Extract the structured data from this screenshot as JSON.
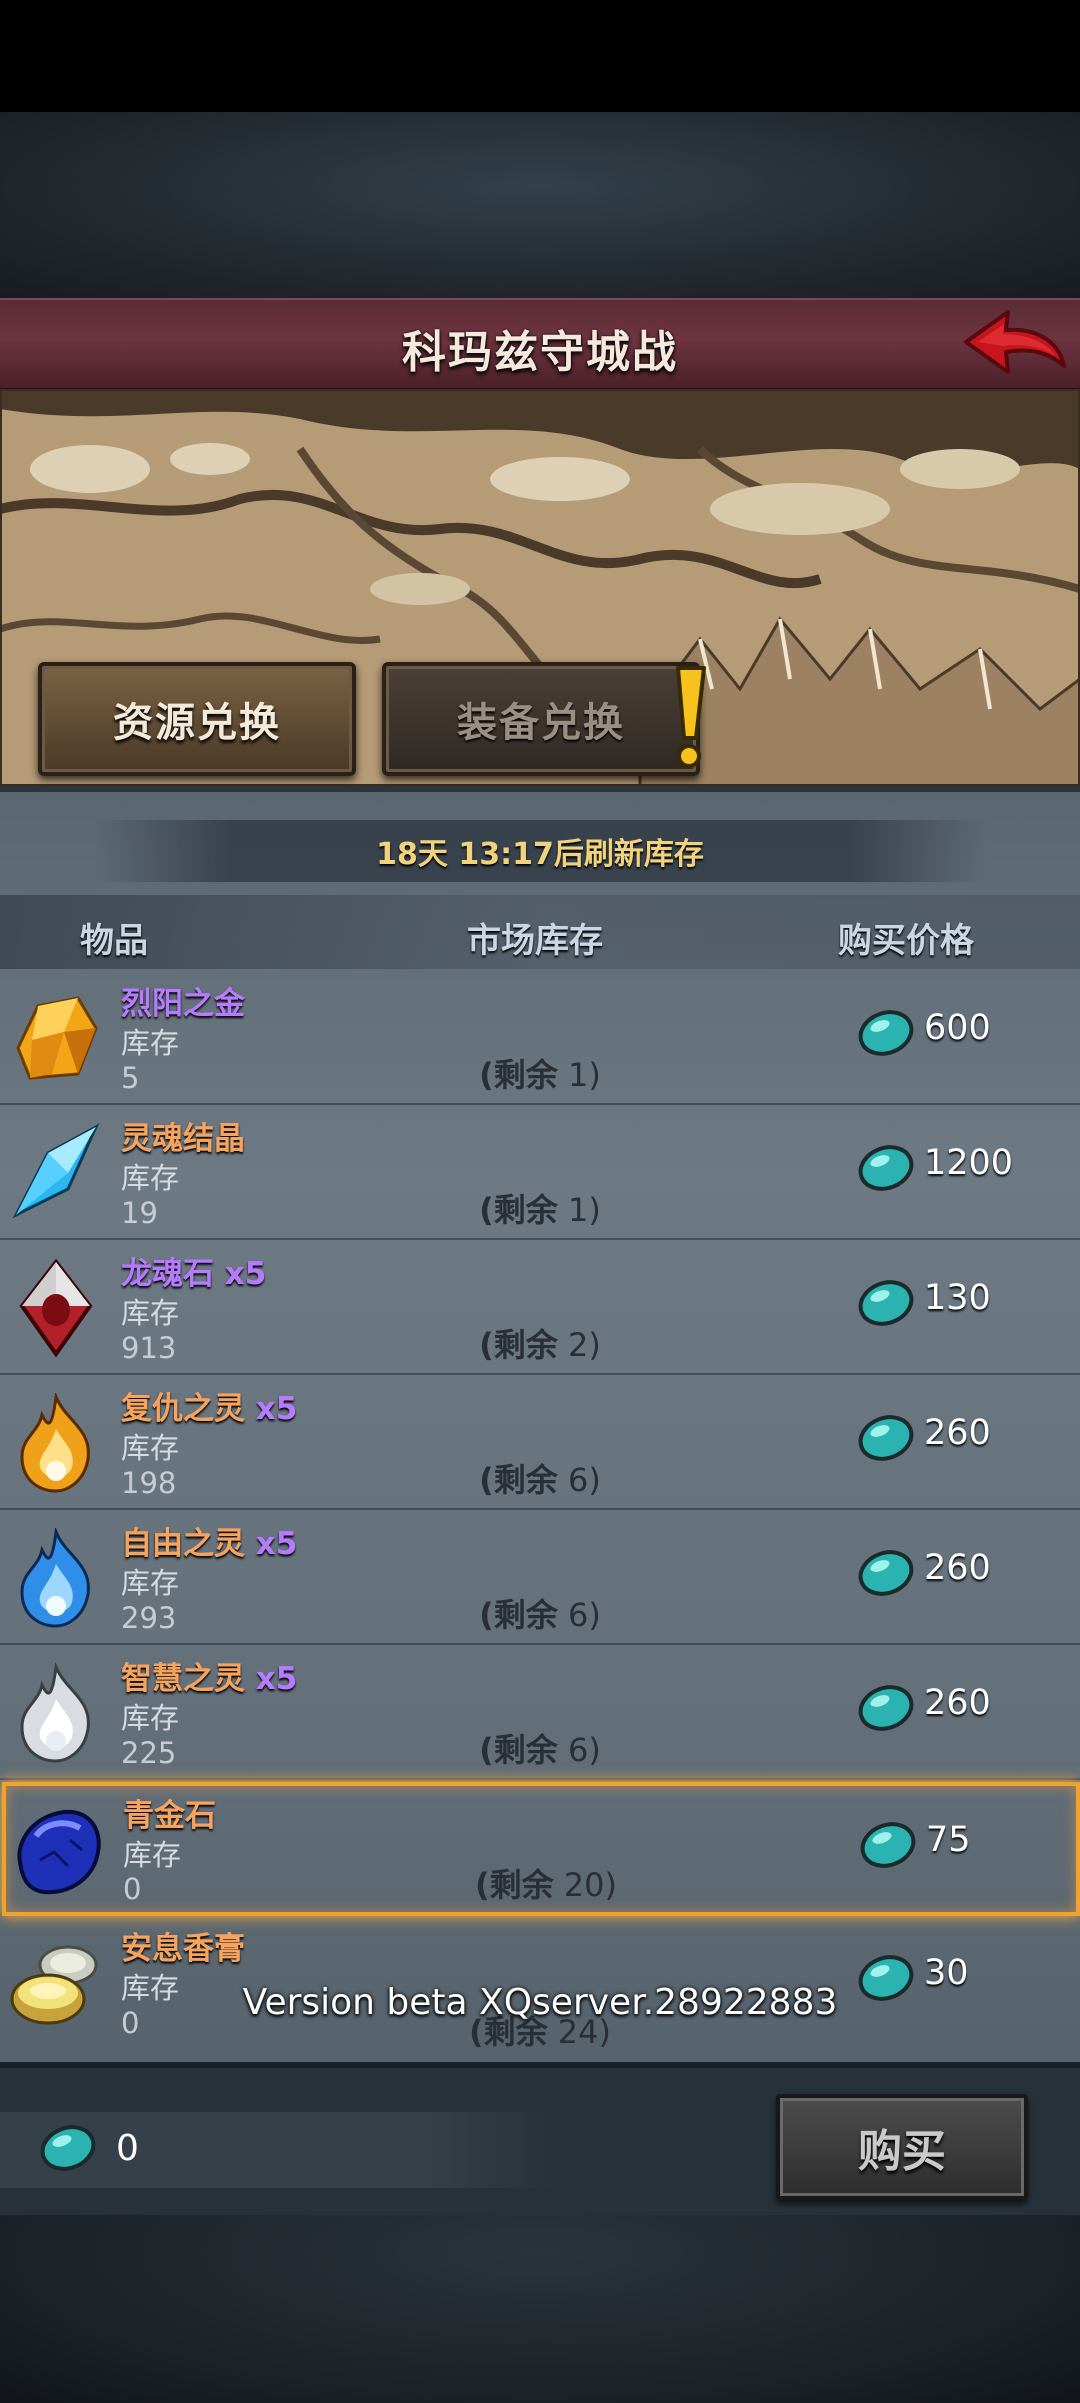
{
  "header": {
    "title": "科玛兹守城战",
    "back_icon": "back-arrow-icon"
  },
  "tabs": [
    {
      "label": "资源兑换",
      "active": true
    },
    {
      "label": "装备兑换",
      "active": false,
      "alert": "!"
    }
  ],
  "refresh_text": "18天 13:17后刷新库存",
  "columns": {
    "item": "物品",
    "stock": "市场库存",
    "price": "购买价格"
  },
  "items": [
    {
      "name": "烈阳之金",
      "qty": "",
      "name_color": "purple",
      "stock_label": "库存",
      "stock": "5",
      "remain_prefix": "(剩余",
      "remain_num": " 1)",
      "price": "600",
      "icon": "gold-crystal-icon"
    },
    {
      "name": "灵魂结晶",
      "qty": "",
      "name_color": "orange",
      "stock_label": "库存",
      "stock": "19",
      "remain_prefix": "(剩余",
      "remain_num": " 1)",
      "price": "1200",
      "icon": "soul-crystal-icon"
    },
    {
      "name": "龙魂石",
      "qty": " x5",
      "name_color": "purple",
      "stock_label": "库存",
      "stock": "913",
      "remain_prefix": "(剩余",
      "remain_num": " 2)",
      "price": "130",
      "icon": "dragon-soul-stone-icon"
    },
    {
      "name": "复仇之灵",
      "qty": " x5",
      "name_color": "orange",
      "stock_label": "库存",
      "stock": "198",
      "remain_prefix": "(剩余",
      "remain_num": " 6)",
      "price": "260",
      "icon": "fire-spirit-icon"
    },
    {
      "name": "自由之灵",
      "qty": " x5",
      "name_color": "orange",
      "stock_label": "库存",
      "stock": "293",
      "remain_prefix": "(剩余",
      "remain_num": " 6)",
      "price": "260",
      "icon": "blue-spirit-icon"
    },
    {
      "name": "智慧之灵",
      "qty": " x5",
      "name_color": "orange",
      "stock_label": "库存",
      "stock": "225",
      "remain_prefix": "(剩余",
      "remain_num": " 6)",
      "price": "260",
      "icon": "white-spirit-icon"
    },
    {
      "name": "青金石",
      "qty": "",
      "name_color": "orange",
      "stock_label": "库存",
      "stock": "0",
      "remain_prefix": "(剩余",
      "remain_num": " 20)",
      "price": "75",
      "icon": "lapis-stone-icon",
      "selected": true
    },
    {
      "name": "安息香膏",
      "qty": "",
      "name_color": "orange",
      "stock_label": "库存",
      "stock": "0",
      "remain_prefix": "(剩余",
      "remain_num": " 24)",
      "price": "30",
      "icon": "balm-tin-icon"
    }
  ],
  "version_text": "Version beta XQserver.28922883",
  "footer": {
    "currency": "0",
    "buy_label": "购买",
    "currency_icon": "teal-gem-icon"
  },
  "colors": {
    "purple": "#b77bff",
    "orange": "#f6a35e",
    "highlight": "#f0a22a",
    "title_bar": "#6e3440"
  }
}
